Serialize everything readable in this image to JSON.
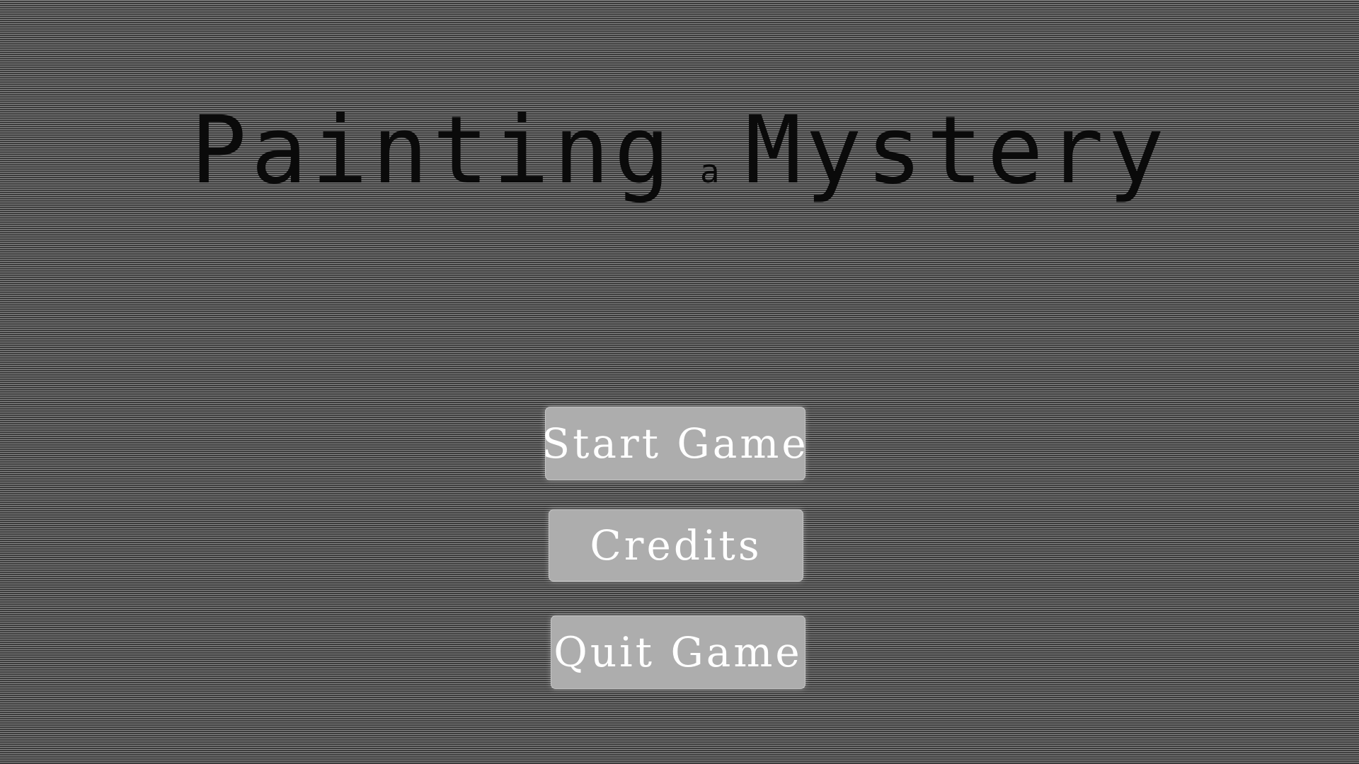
{
  "title": {
    "word1": "Painting",
    "connector": "a",
    "word2": "Mystery"
  },
  "menu": {
    "start_label": "Start Game",
    "credits_label": "Credits",
    "quit_label": "Quit Game"
  },
  "colors": {
    "title_text": "#0a0a0a",
    "button_bg": "#adadad",
    "button_text": "#ffffff"
  }
}
